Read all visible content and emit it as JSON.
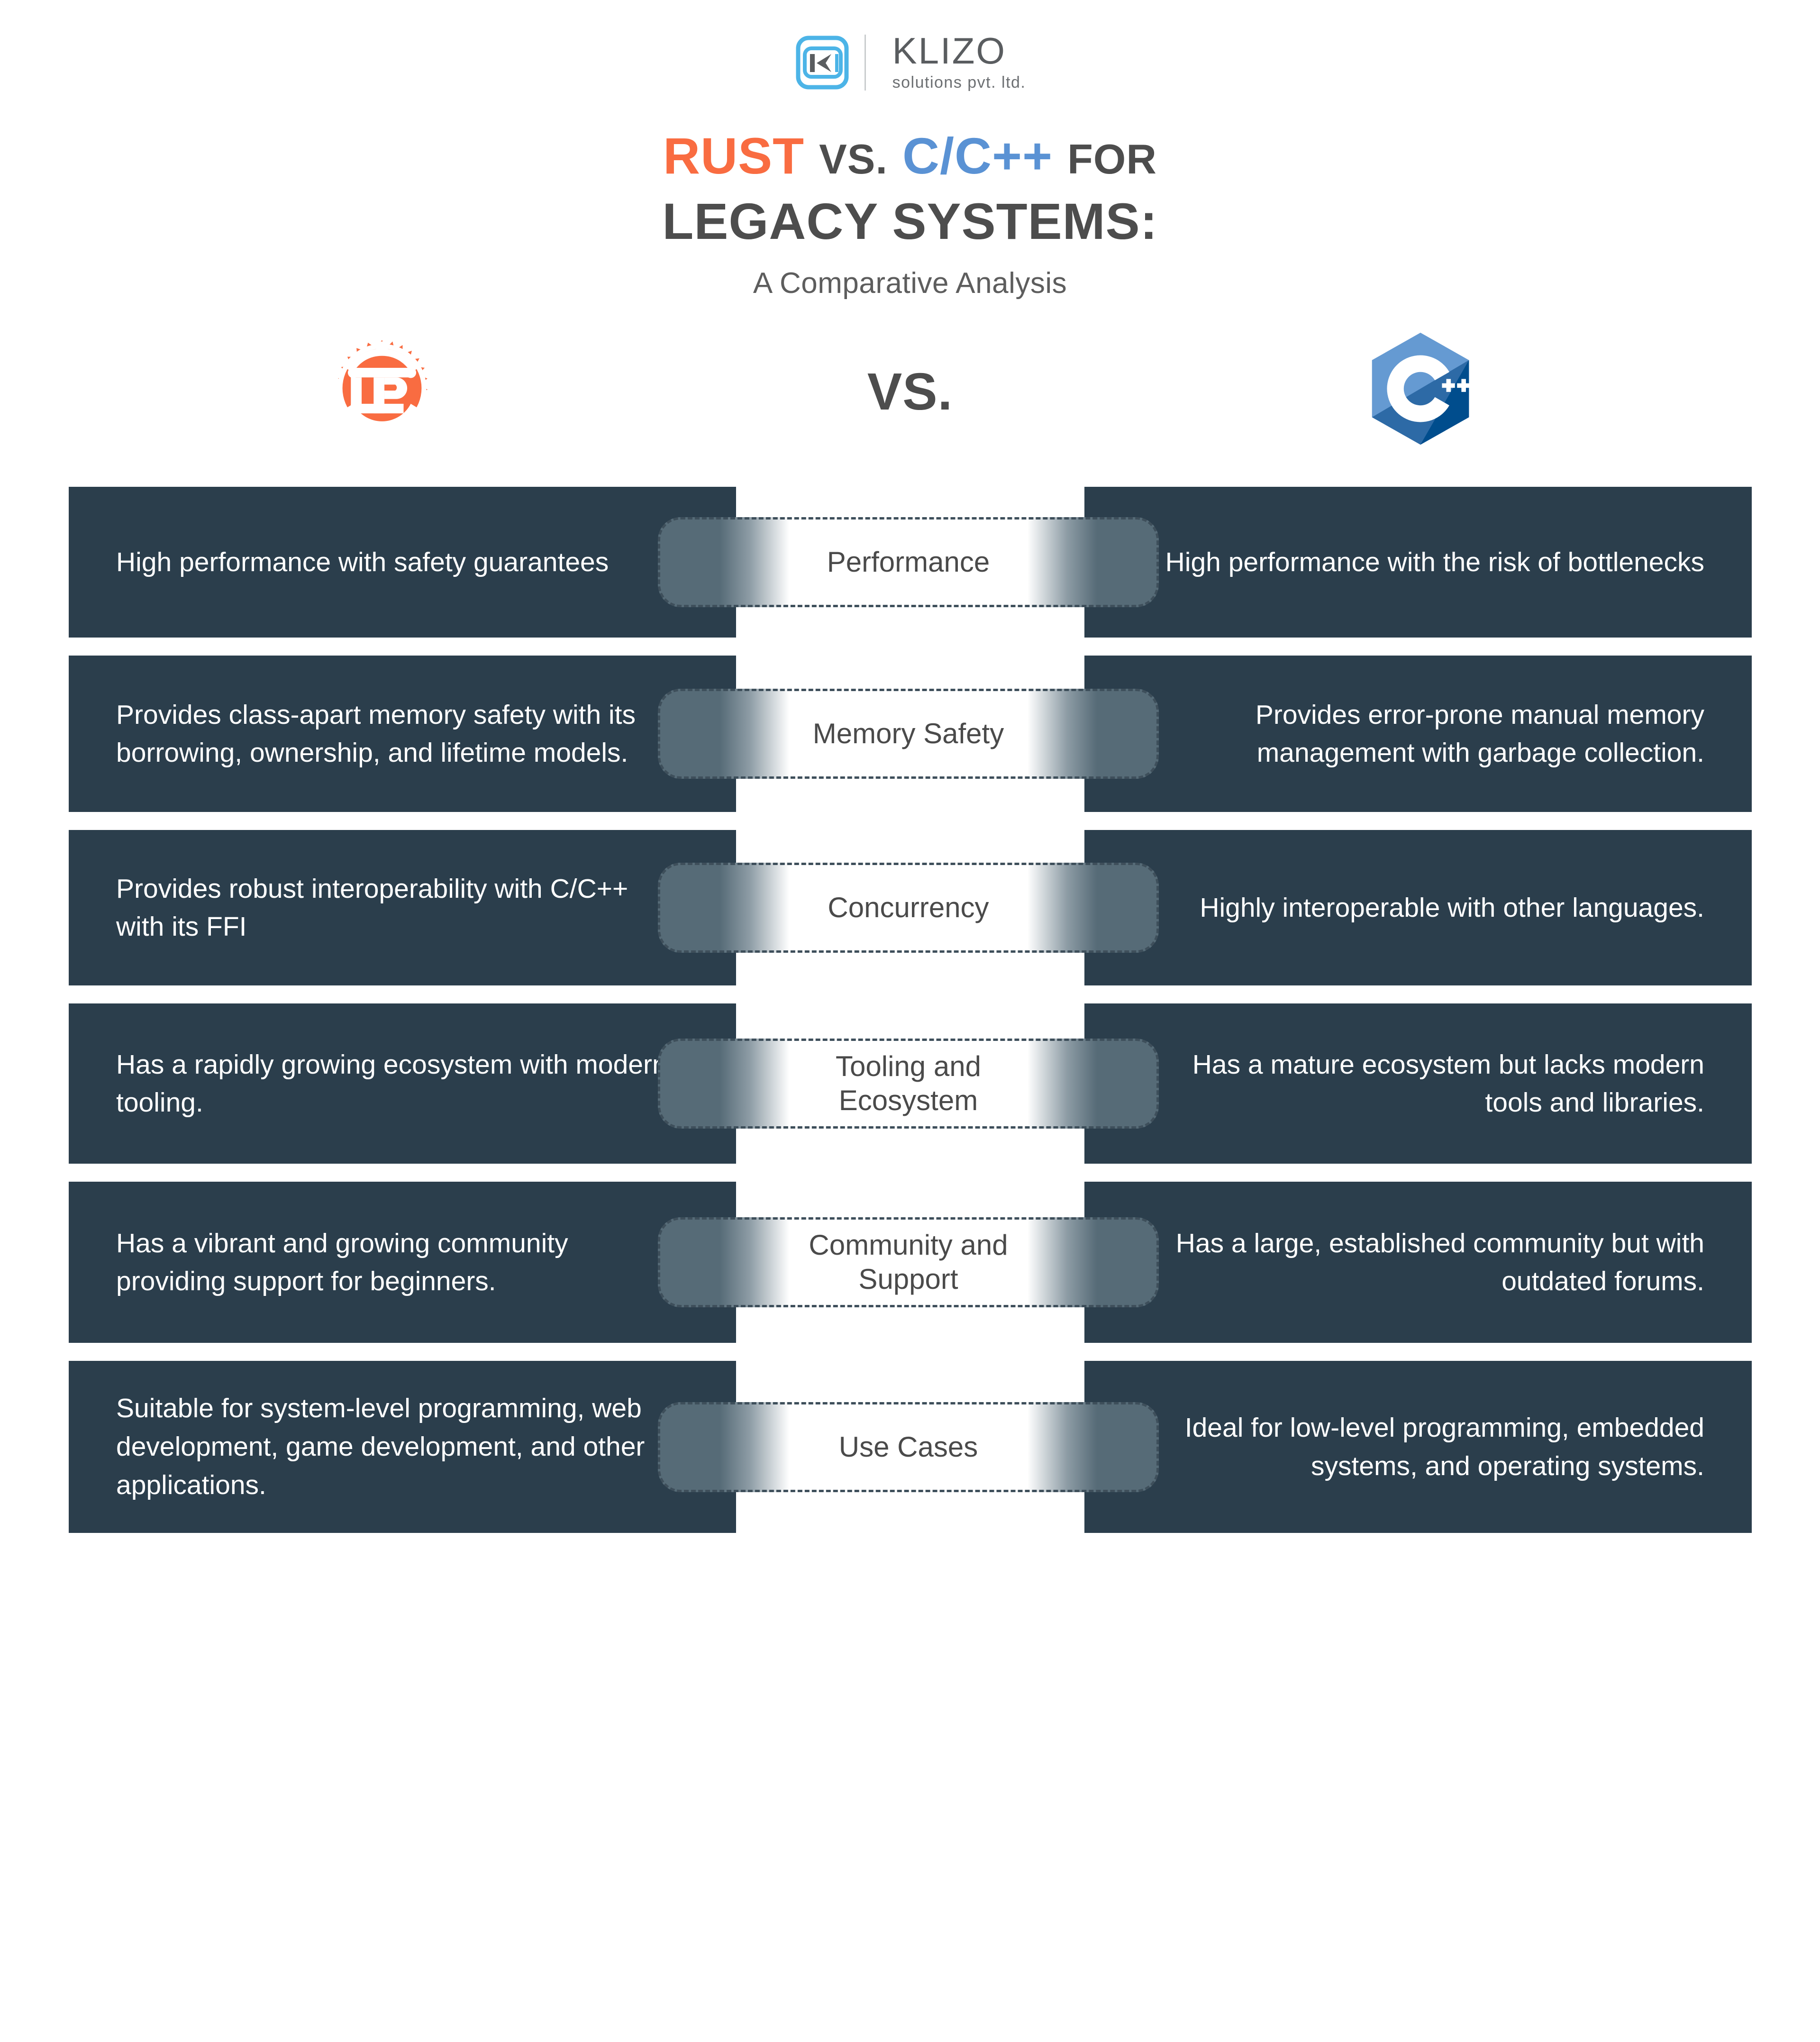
{
  "brand": {
    "name": "KLIZO",
    "tagline": "solutions pvt. ltd.",
    "mark_icon": "klizo-k-mark-icon",
    "mark_color": "#4cb4e7",
    "word_color": "#5a5d60"
  },
  "title": {
    "part_rust": "RUST",
    "part_vs": "VS.",
    "part_cpp": "C/C++",
    "part_for": "FOR",
    "line2": "LEGACY SYSTEMS:",
    "subtitle": "A Comparative Analysis",
    "rust_color": "#f96c41",
    "cpp_color": "#5a92d4",
    "neutral_color": "#4d4d4d"
  },
  "logos": {
    "left_icon": "rust-gear-logo-icon",
    "left_alt": "Rust",
    "left_color": "#f96c41",
    "vs_label": "VS.",
    "right_icon": "cplusplus-hexagon-logo-icon",
    "right_alt": "C++",
    "right_color_light": "#659ad2",
    "right_color_mid": "#00599c",
    "right_color_dark": "#004482"
  },
  "theme": {
    "panel_bg": "#2b3e4c",
    "panel_text": "#ffffff",
    "tab_edge": "#566b77",
    "tab_center": "#ffffff",
    "tab_border": "#3e4f5b",
    "tab_label_color": "#4a4a4a",
    "page_bg": "#ffffff"
  },
  "comparison": {
    "left_column_header": "Rust",
    "right_column_header": "C/C++",
    "rows": [
      {
        "criterion": "Performance",
        "rust": "High performance with safety guarantees",
        "cpp": "High performance with the risk of bottlenecks"
      },
      {
        "criterion": "Memory Safety",
        "rust": "Provides class-apart memory safety with its borrowing, ownership, and lifetime models.",
        "cpp": "Provides error-prone manual memory management with garbage collection."
      },
      {
        "criterion": "Concurrency",
        "rust": "Provides robust interoperability with C/C++ with its FFI",
        "cpp": "Highly interoperable with other languages."
      },
      {
        "criterion": "Tooling and\nEcosystem",
        "rust": "Has a rapidly growing ecosystem with modern tooling.",
        "cpp": "Has a mature ecosystem but lacks modern tools and libraries."
      },
      {
        "criterion": "Community and\nSupport",
        "rust": "Has a vibrant and growing community providing support for beginners.",
        "cpp": "Has a large, established community but with outdated forums."
      },
      {
        "criterion": "Use Cases",
        "rust": "Suitable for system-level programming, web development, game development, and other applications.",
        "cpp": "Ideal for low-level programming, embedded systems, and operating systems."
      }
    ]
  }
}
